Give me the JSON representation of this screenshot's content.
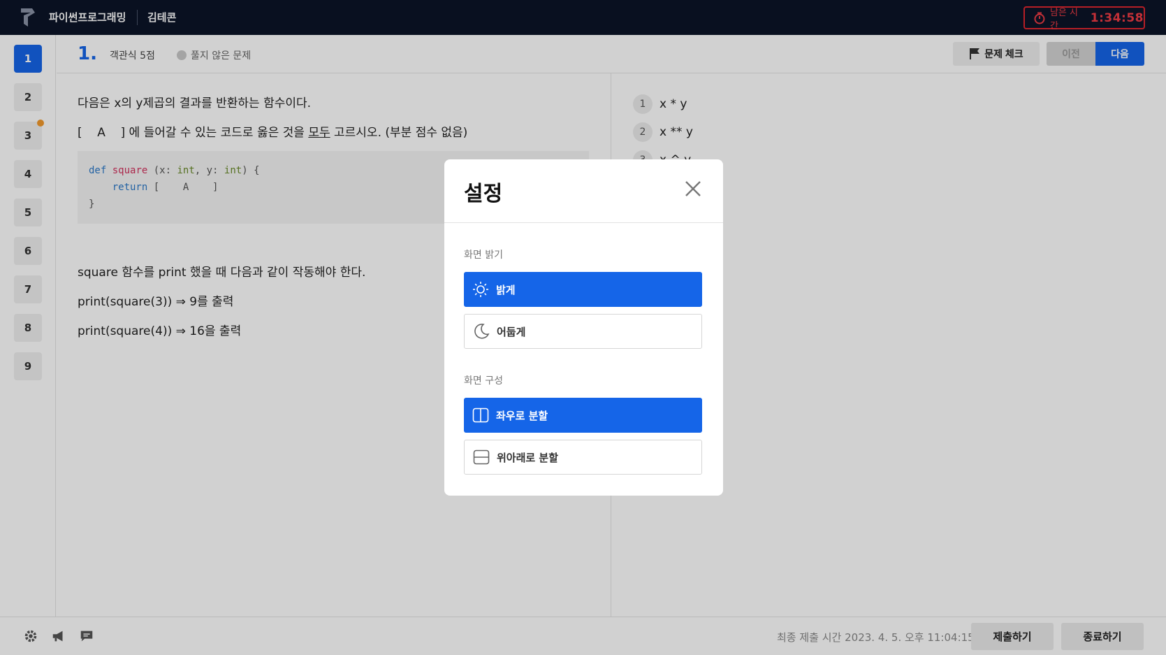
{
  "app": {
    "title": "파이썬프로그래밍",
    "user": "김테콘",
    "timer_label": "남은 시간",
    "timer_value": "1:34:58"
  },
  "nav": {
    "questions": [
      "1",
      "2",
      "3",
      "4",
      "5",
      "6",
      "7",
      "8",
      "9"
    ],
    "active": "1",
    "flagged": "3"
  },
  "header": {
    "number": "1.",
    "type": "객관식 5점",
    "status": "풀지 않은 문제",
    "check_label": "문제 체크",
    "prev_label": "이전",
    "next_label": "다음"
  },
  "question": {
    "line1": "다음은 x의 y제곱의 결과를 반환하는 함수이다.",
    "line2_pre": "[    A    ] 에 들어갈 수 있는 코드로 옳은 것을 ",
    "line2_underline": "모두",
    "line2_post": " 고르시오. (부분 점수 없음)",
    "code": {
      "kw_def": "def",
      "fn_name": "square",
      "p_open": " (x: ",
      "t_int1": "int",
      "p_mid": ", y: ",
      "t_int2": "int",
      "p_close": ") {",
      "kw_return": "return",
      "return_rest": " [    A    ]",
      "brace_close": "}"
    },
    "line3": "square 함수를 print 했을 때 다음과 같이 작동해야 한다.",
    "line4": "print(square(3)) ⇒ 9를 출력",
    "line5": "print(square(4)) ⇒ 16을 출력"
  },
  "answers": [
    {
      "num": "1",
      "text": "x * y"
    },
    {
      "num": "2",
      "text": "x ** y"
    },
    {
      "num": "3",
      "text": "x ^ y"
    }
  ],
  "footer": {
    "submit_time": "최종 제출 시간 2023. 4. 5. 오후 11:04:15",
    "submit_label": "제출하기",
    "end_label": "종료하기"
  },
  "modal": {
    "title": "설정",
    "brightness_label": "화면 밝기",
    "bright_option": "밝게",
    "dark_option": "어둡게",
    "layout_label": "화면 구성",
    "split_lr": "좌우로 분할",
    "split_tb": "위아래로 분할"
  },
  "colors": {
    "primary": "#1565e8",
    "topbar": "#0b1428",
    "timer_red": "#e0262f",
    "flag_dot": "#f29a2e"
  }
}
